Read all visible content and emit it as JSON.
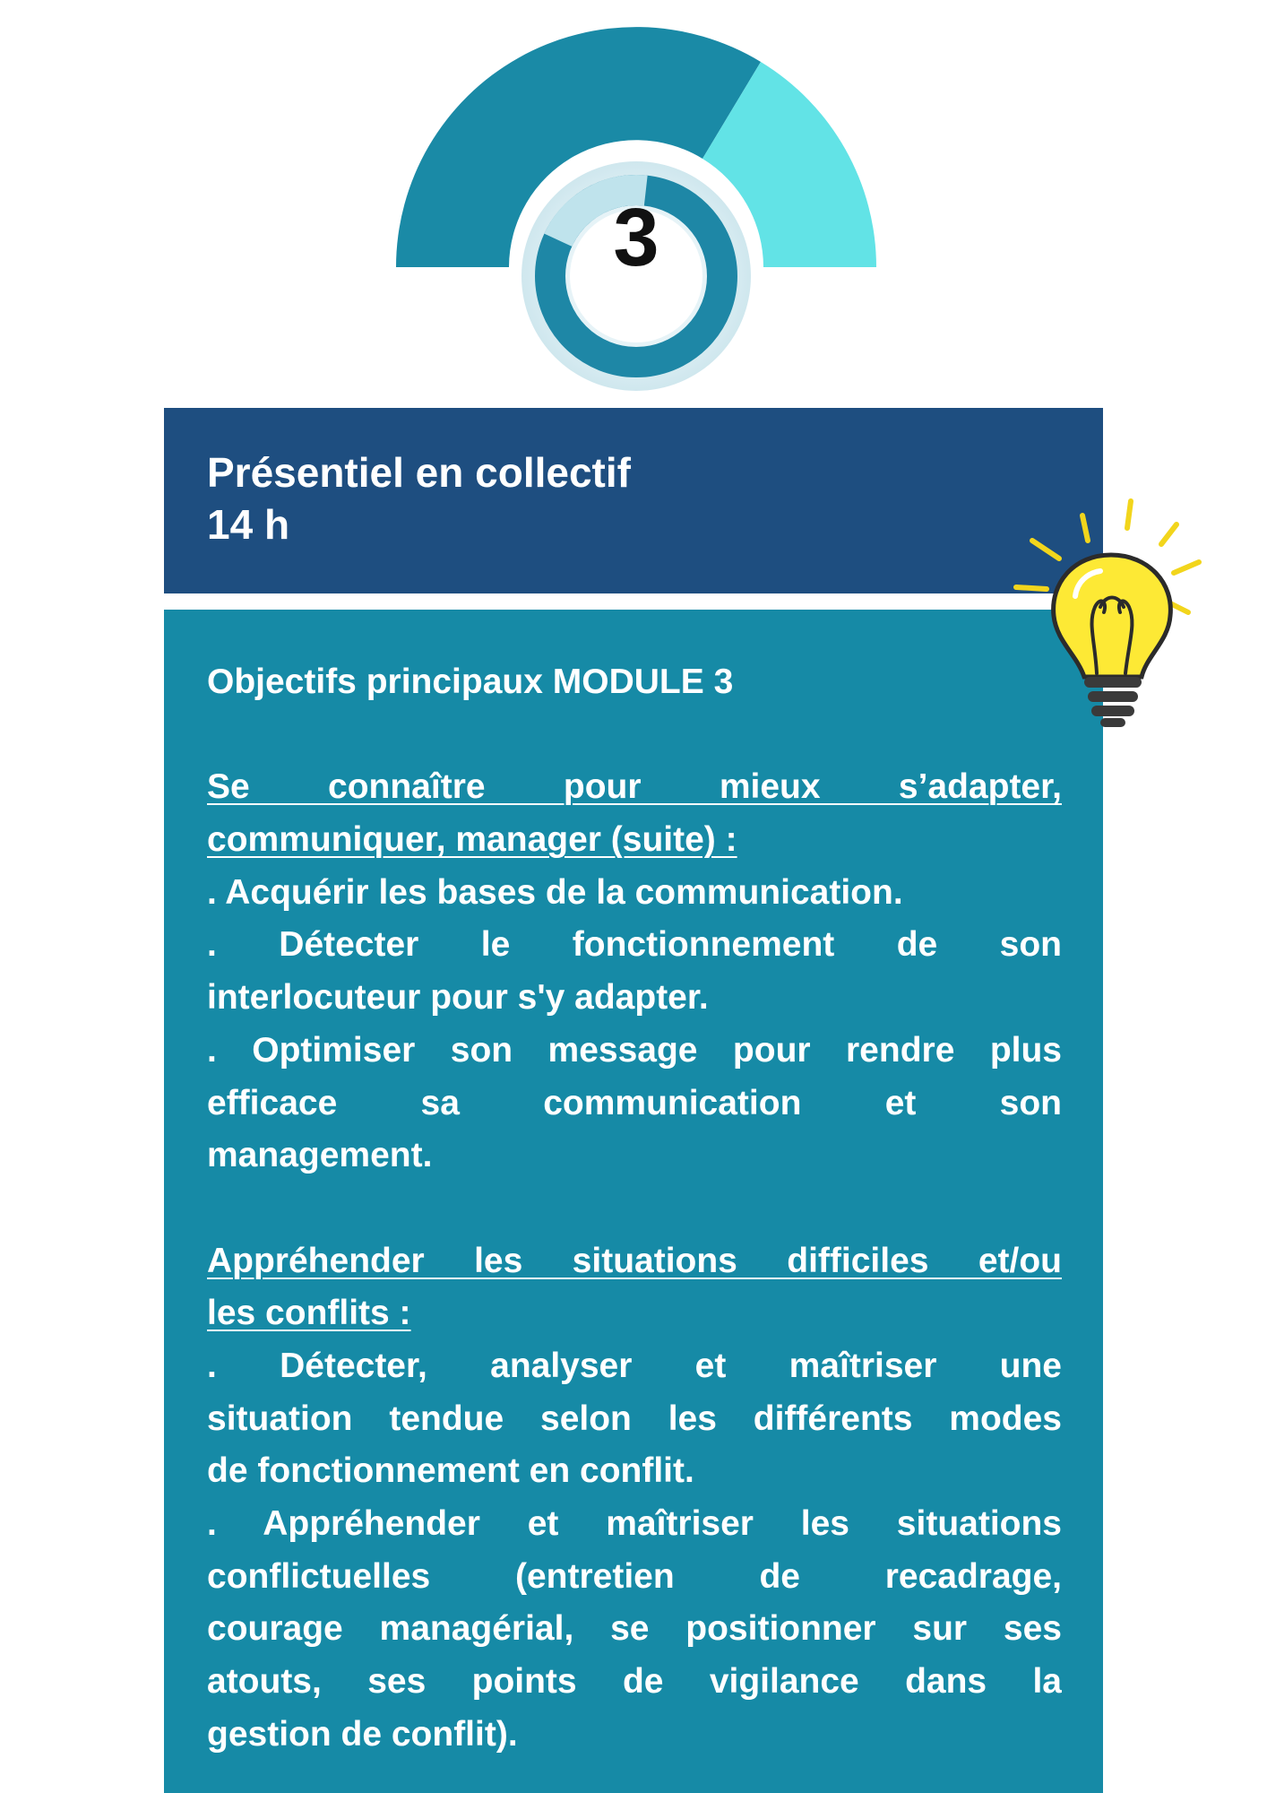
{
  "badge": {
    "number": "3",
    "colors": {
      "dark_arc": "#1a8aa6",
      "light_arc": "#62e3e6",
      "ring": "#1e87a6"
    }
  },
  "header": {
    "line1": "Présentiel en collectif",
    "line2": "14 h",
    "background": "#1e4e80"
  },
  "content": {
    "background": "#168aa6",
    "title": "Objectifs principaux MODULE 3",
    "section1": {
      "heading_line1": "Se connaître pour mieux s’adapter,",
      "heading_line2": "communiquer, manager (suite) :",
      "bullet1": ". Acquérir les bases de la communication.",
      "bullet2_line1": ". Détecter le fonctionnement de son",
      "bullet2_line2": "interlocuteur pour s'y adapter.",
      "bullet3_line1": ". Optimiser son message pour rendre plus",
      "bullet3_line2": "efficace sa communication et son",
      "bullet3_line3": "management."
    },
    "section2": {
      "heading_line1": "Appréhender les situations difficiles et/ou",
      "heading_line2": "les conflits :",
      "bullet1_line1": ". Détecter, analyser et maîtriser une",
      "bullet1_line2": "situation tendue selon les différents modes",
      "bullet1_line3": "de fonctionnement en conflit.",
      "bullet2_line1": ". Appréhender et maîtriser les situations",
      "bullet2_line2": "conflictuelles (entretien de recadrage,",
      "bullet2_line3": "courage managérial, se positionner sur ses",
      "bullet2_line4": "atouts, ses points de vigilance dans la",
      "bullet2_line5": "gestion de conflit)."
    }
  },
  "icons": {
    "gauge": "gauge-icon",
    "bulb": "lightbulb-icon"
  }
}
